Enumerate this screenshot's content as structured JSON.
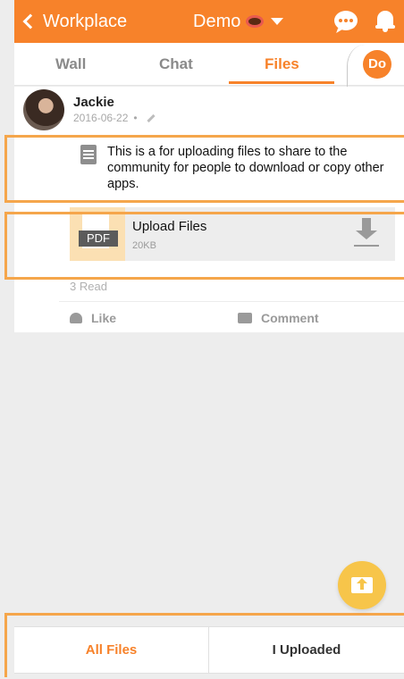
{
  "header": {
    "back_label": "Workplace",
    "title": "Demo"
  },
  "tabs": [
    {
      "label": "Wall",
      "active": false
    },
    {
      "label": "Chat",
      "active": false
    },
    {
      "label": "Files",
      "active": true
    }
  ],
  "do_button": "Do",
  "post": {
    "author": "Jackie",
    "date": "2016-06-22",
    "date_sep": "•",
    "description": "This is a for uploading files to share to the community for people to download or copy other apps.",
    "attachment": {
      "type_badge": "PDF",
      "name": "Upload Files",
      "size": "20KB"
    },
    "reads": "3 Read",
    "like_label": "Like",
    "comment_label": "Comment"
  },
  "bottom_tabs": [
    {
      "label": "All Files",
      "active": true
    },
    {
      "label": "I Uploaded",
      "active": false
    }
  ],
  "colors": {
    "accent": "#f7822a",
    "fab": "#f7c54a",
    "highlight": "#f5a64b"
  },
  "icons": [
    "back-chevron-icon",
    "donut-icon",
    "caret-down-icon",
    "chat-bubble-icon",
    "bell-icon",
    "pencil-icon",
    "document-icon",
    "download-icon",
    "heart-icon",
    "comment-icon",
    "upload-icon"
  ]
}
